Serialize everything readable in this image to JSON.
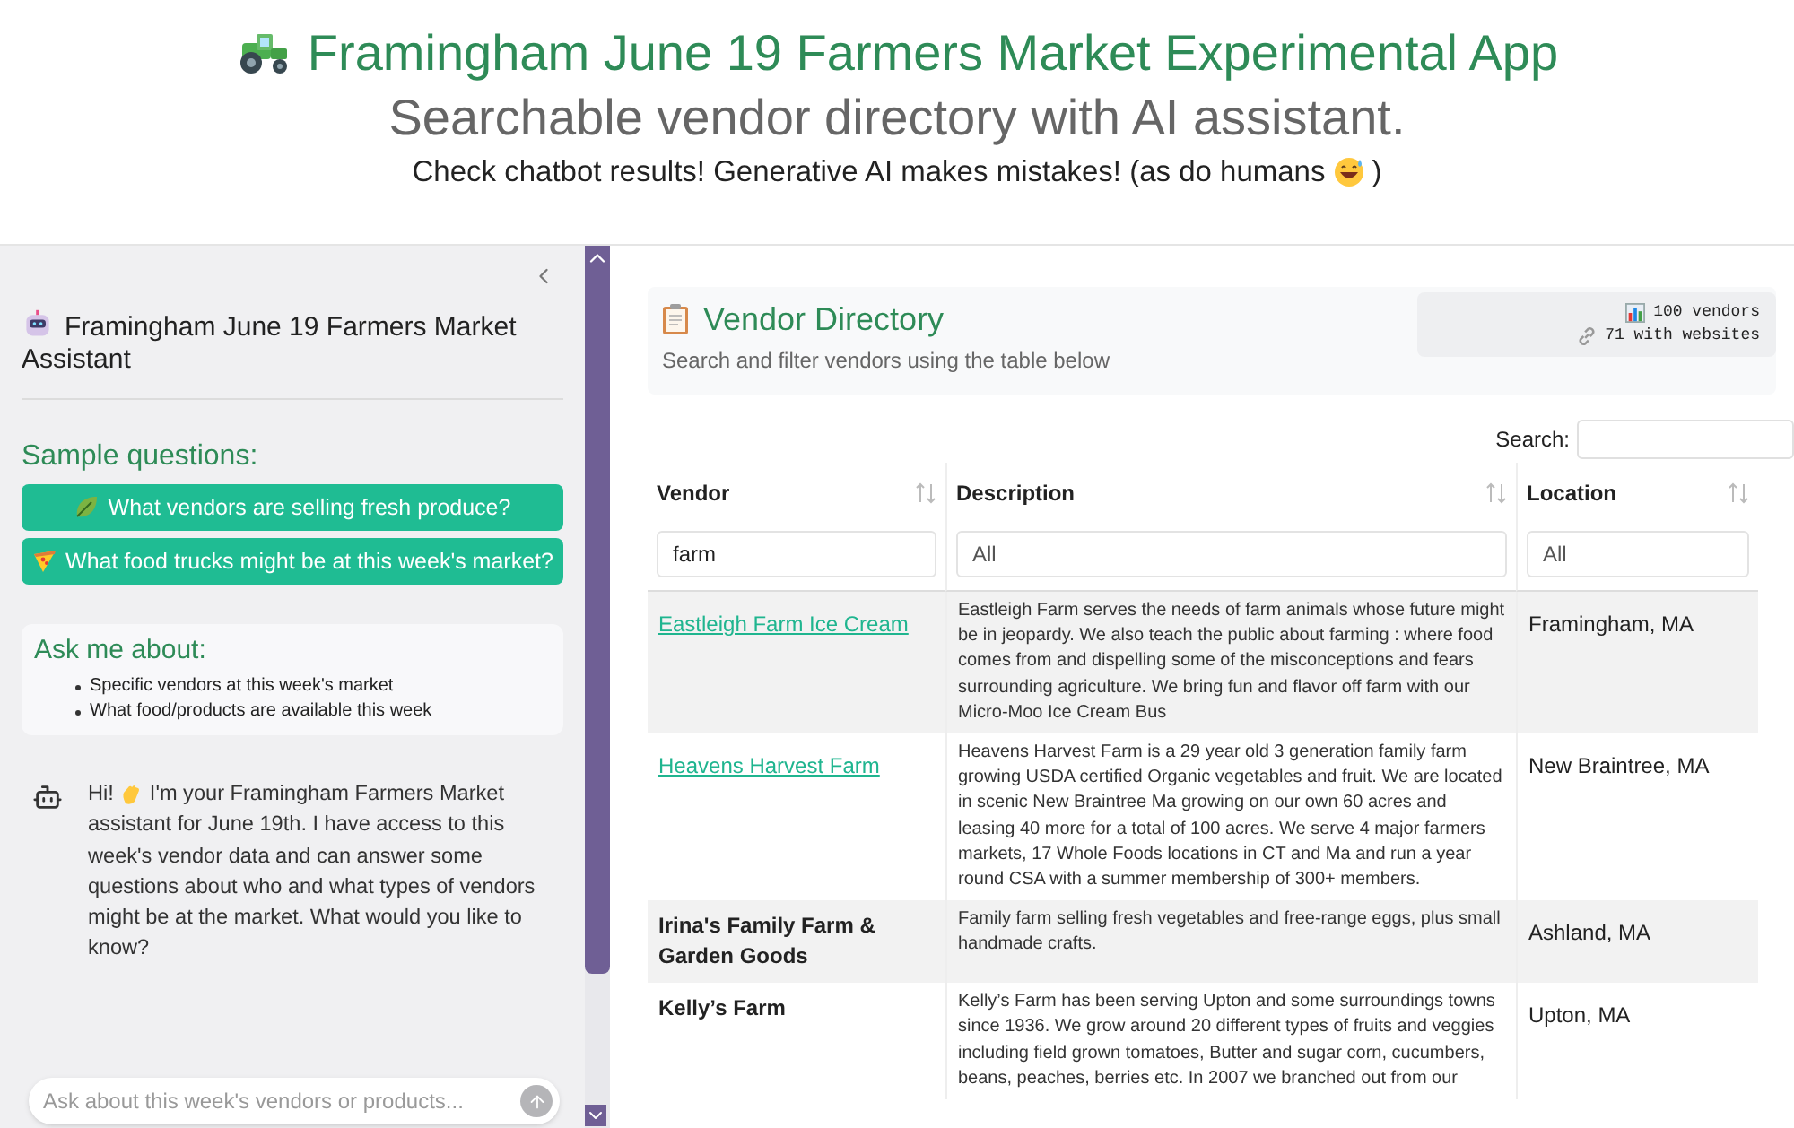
{
  "header": {
    "title": "Framingham June 19 Farmers Market Experimental App",
    "subtitle": "Searchable vendor directory with AI assistant.",
    "note": "Check chatbot results! Generative AI makes mistakes! (as do humans",
    "note_end": ")"
  },
  "sidebar": {
    "title": "Framingham June 19 Farmers Market Assistant",
    "sample_heading": "Sample questions:",
    "sample_questions": [
      {
        "label": "What vendors are selling fresh produce?",
        "kind": "leaf"
      },
      {
        "label": "What food trucks might be at this week's market?",
        "kind": "pizza"
      }
    ],
    "about": {
      "heading": "Ask me about:",
      "items": [
        "Specific vendors at this week's market",
        "What food/products are available this week"
      ]
    },
    "message": {
      "greeting": "Hi!",
      "first_line": "I'm your Framingham Farmers Market",
      "text": "assistant for June 19th. I have access to this week's vendor data and can answer some questions about who and what types of vendors might be at the market. What would you like to know?"
    },
    "input": {
      "placeholder": "Ask about this week's vendors or products..."
    }
  },
  "directory": {
    "title": "Vendor Directory",
    "subtitle": "Search and filter vendors using the table below",
    "stats": [
      {
        "kind": "chart",
        "text": "100 vendors"
      },
      {
        "kind": "link",
        "text": "71 with websites"
      }
    ],
    "search_label": "Search:",
    "columns": [
      {
        "label": "Vendor",
        "filter": "farm"
      },
      {
        "label": "Description",
        "filter_placeholder": "All"
      },
      {
        "label": "Location",
        "filter_placeholder": "All"
      }
    ],
    "rows": [
      {
        "vendor": "Eastleigh Farm Ice Cream",
        "link": true,
        "description": "Eastleigh Farm serves the needs of farm animals whose future might be in jeopardy. We also teach the public about farming : where food comes from and dispelling some of the misconceptions and fears surrounding agriculture. We bring fun and flavor off farm with our Micro-Moo Ice Cream Bus",
        "location": "Framingham, MA"
      },
      {
        "vendor": "Heavens Harvest Farm",
        "link": true,
        "description": "Heavens Harvest Farm is a 29 year old 3 generation family farm growing USDA certified Organic vegetables and fruit. We are located in scenic New Braintree Ma growing on our own 60 acres and leasing 40 more for a total of 100 acres. We serve 4 major farmers markets, 17 Whole Foods locations in CT and Ma and run a year round CSA with a summer membership of 300+ members.",
        "location": "New Braintree, MA"
      },
      {
        "vendor": "Irina's Family Farm & Garden Goods",
        "link": false,
        "description": "Family farm selling fresh vegetables and free-range eggs, plus small handmade crafts.",
        "location": "Ashland, MA"
      },
      {
        "vendor": "Kelly’s Farm",
        "link": false,
        "description": "Kelly’s Farm has been serving Upton and some surroundings towns since 1936. We grow around 20 different types of fruits and veggies including field grown tomatoes, Butter and sugar corn, cucumbers, beans, peaches, berries etc. In 2007 we branched out from our",
        "location": "Upton, MA"
      }
    ]
  }
}
